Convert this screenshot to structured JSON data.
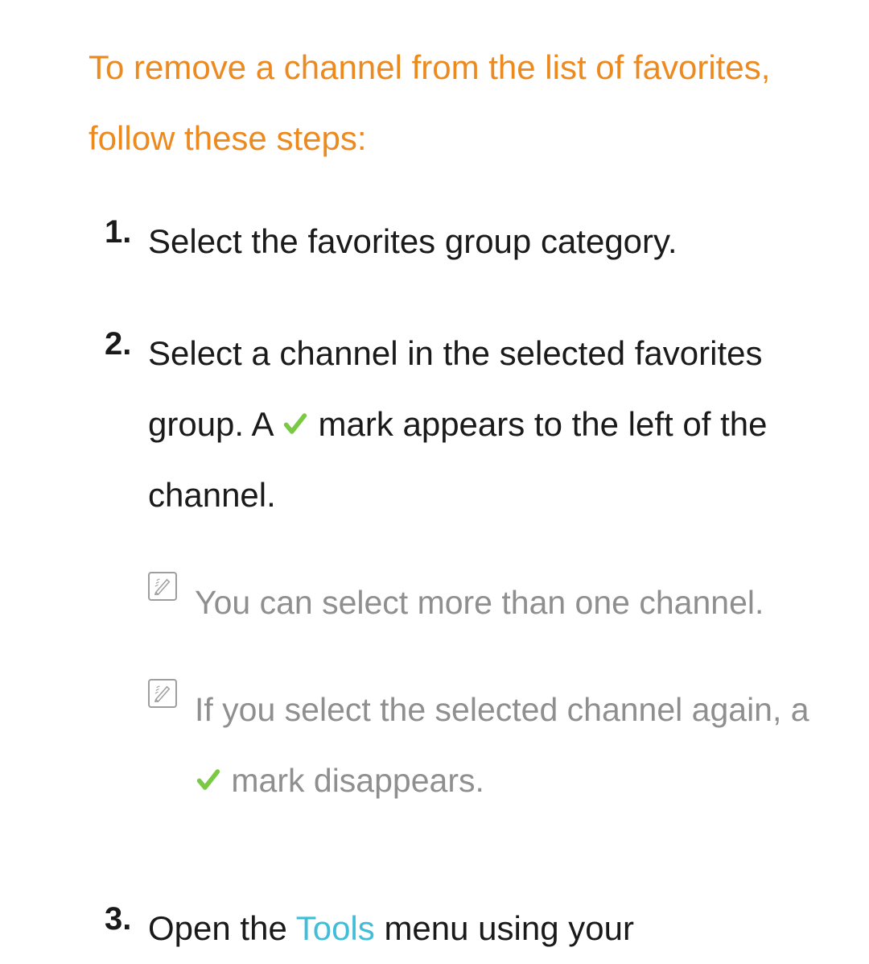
{
  "heading": "To remove a channel from the list of favorites, follow these steps:",
  "steps": {
    "s1": {
      "num": "1.",
      "text": "Select the favorites group category."
    },
    "s2": {
      "num": "2.",
      "text_before": "Select a channel in the selected favorites group. A ",
      "text_after": " mark appears to the left of the channel.",
      "notes": {
        "n1": "You can select more than one channel.",
        "n2_before": "If you select the selected channel again, a ",
        "n2_after": " mark disappears."
      }
    },
    "s3": {
      "num": "3.",
      "text_before": "Open the ",
      "tools_word": "Tools",
      "text_after": " menu using your"
    }
  },
  "colors": {
    "heading": "#ec8a1f",
    "body": "#1a1a1a",
    "note": "#8f8f8f",
    "tools": "#3fbdd9",
    "check": "#7ac943"
  }
}
